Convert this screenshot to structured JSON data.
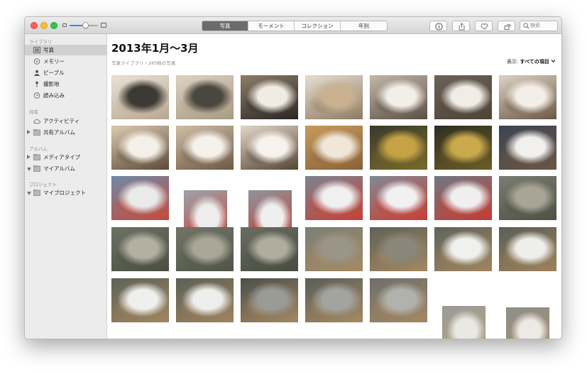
{
  "window": {
    "tabs": [
      {
        "label": "写真",
        "active": true
      },
      {
        "label": "モーメント",
        "active": false
      },
      {
        "label": "コレクション",
        "active": false
      },
      {
        "label": "年別",
        "active": false
      }
    ],
    "toolbar_icons": [
      "info-icon",
      "share-icon",
      "heart-icon",
      "rotate-icon"
    ],
    "search_placeholder": "検索",
    "zoom_slider_value": 0.55
  },
  "sidebar": {
    "library_header": "ライブラリ",
    "library_items": [
      {
        "label": "写真",
        "icon": "photos-icon",
        "selected": true
      },
      {
        "label": "メモリー",
        "icon": "memories-icon",
        "selected": false
      },
      {
        "label": "ピープル",
        "icon": "people-icon",
        "selected": false
      },
      {
        "label": "撮影地",
        "icon": "places-pin-icon",
        "selected": false
      },
      {
        "label": "読み込み",
        "icon": "imports-clock-icon",
        "selected": false
      }
    ],
    "shared_header": "共有",
    "shared_items": [
      {
        "label": "アクティビティ",
        "icon": "cloud-icon",
        "disclosure": "none"
      },
      {
        "label": "共有アルバム",
        "icon": "folder-icon",
        "disclosure": "collapsed"
      }
    ],
    "albums_header": "アルバム",
    "album_items": [
      {
        "label": "メディアタイプ",
        "icon": "folder-icon",
        "disclosure": "collapsed"
      },
      {
        "label": "マイアルバム",
        "icon": "folder-icon",
        "disclosure": "expanded"
      }
    ],
    "projects_header": "プロジェクト",
    "project_items": [
      {
        "label": "マイプロジェクト",
        "icon": "folder-icon",
        "disclosure": "expanded"
      }
    ]
  },
  "main": {
    "title": "2013年1月〜3月",
    "subtitle": "写真ライブラリ・265枚の写真",
    "display_label": "表示:",
    "display_value": "すべての項目",
    "photos": [
      {
        "subject": "cat-on-wooden-step",
        "colors": [
          "#e9e2d6",
          "#3b3a35",
          "#b8a891"
        ]
      },
      {
        "subject": "cat-on-wooden-step",
        "colors": [
          "#ddd3c2",
          "#4a4640",
          "#a89a82"
        ]
      },
      {
        "subject": "cat-closeup-sitting",
        "colors": [
          "#8d7e6a",
          "#f0ece4",
          "#2a2622"
        ]
      },
      {
        "subject": "blurry-cat-face",
        "colors": [
          "#e7ded1",
          "#c9b190",
          "#8f7b64"
        ]
      },
      {
        "subject": "cat-face-closeup",
        "colors": [
          "#c2b8a9",
          "#f2efe9",
          "#5c5046"
        ]
      },
      {
        "subject": "cat-face-closeup",
        "colors": [
          "#6b6358",
          "#f1ede6",
          "#4f4338"
        ]
      },
      {
        "subject": "cat-face-closeup",
        "colors": [
          "#dcd2c4",
          "#f3efe8",
          "#6b5945"
        ]
      },
      {
        "subject": "cat-looking-down",
        "colors": [
          "#dccbb2",
          "#f4f0e9",
          "#5d4a36"
        ]
      },
      {
        "subject": "cat-looking-down",
        "colors": [
          "#cfbea6",
          "#f5f2ec",
          "#6e5843"
        ]
      },
      {
        "subject": "cat-lying",
        "colors": [
          "#e1d8c9",
          "#f6f3ee",
          "#554434"
        ]
      },
      {
        "subject": "cat-fur-blur",
        "colors": [
          "#c79a5e",
          "#f0e7d8",
          "#8a6237"
        ]
      },
      {
        "subject": "striped-fur-closeup",
        "colors": [
          "#3a3a2c",
          "#c4a245",
          "#7a6b2b"
        ]
      },
      {
        "subject": "striped-fur-closeup",
        "colors": [
          "#2e2e22",
          "#caa84c",
          "#6c5d26"
        ]
      },
      {
        "subject": "cat-lying-wooden-floor",
        "colors": [
          "#3c4452",
          "#f2f0ec",
          "#6a5744"
        ]
      },
      {
        "subject": "cat-with-heart-toy",
        "colors": [
          "#6e8aa8",
          "#eaeaea",
          "#c64a3a"
        ]
      },
      {
        "subject": "cat-with-heart-toy-tilted",
        "colors": [
          "#9ba3aa",
          "#ededed",
          "#cc3c32"
        ]
      },
      {
        "subject": "cat-with-heart-toy-tilted",
        "colors": [
          "#8d959c",
          "#efefef",
          "#c43630"
        ]
      },
      {
        "subject": "cat-with-heart-toy",
        "colors": [
          "#7c8590",
          "#f0f0f0",
          "#c74035"
        ]
      },
      {
        "subject": "cat-with-heart-toy",
        "colors": [
          "#818a94",
          "#f1f1f1",
          "#c93e33"
        ]
      },
      {
        "subject": "cat-with-heart-toy",
        "colors": [
          "#6f7985",
          "#efefef",
          "#c53b31"
        ]
      },
      {
        "subject": "shrine-cat-stone-steps",
        "colors": [
          "#7a7d72",
          "#a8a596",
          "#4d5142"
        ]
      },
      {
        "subject": "shrine-cat-stone-steps",
        "colors": [
          "#6d7266",
          "#b3b0a2",
          "#4a4f40"
        ]
      },
      {
        "subject": "shrine-cat-stone-steps",
        "colors": [
          "#727669",
          "#a9a698",
          "#505547"
        ]
      },
      {
        "subject": "shrine-cat-stone-steps",
        "colors": [
          "#6a6e62",
          "#b0ad9f",
          "#484c3f"
        ]
      },
      {
        "subject": "tabby-cat-on-steps",
        "colors": [
          "#7b7f77",
          "#9a9587",
          "#a58a63"
        ]
      },
      {
        "subject": "tabby-cat-sitting",
        "colors": [
          "#5f6259",
          "#8a8679",
          "#a48862"
        ]
      },
      {
        "subject": "shrine-cats-paper-streamers",
        "colors": [
          "#60645a",
          "#f0f0ee",
          "#a0855f"
        ]
      },
      {
        "subject": "shrine-cats-paper-streamers",
        "colors": [
          "#5b5f55",
          "#eeeeec",
          "#9e835d"
        ]
      },
      {
        "subject": "shrine-cats-streamers",
        "colors": [
          "#5e6258",
          "#efefed",
          "#a1865f"
        ]
      },
      {
        "subject": "shrine-cats-streamers",
        "colors": [
          "#5c6056",
          "#eeeeec",
          "#9f845e"
        ]
      },
      {
        "subject": "tabby-cat-on-path",
        "colors": [
          "#4c4e49",
          "#9a9a96",
          "#a48863"
        ]
      },
      {
        "subject": "tabby-cat-on-path",
        "colors": [
          "#5b5d58",
          "#a3a39f",
          "#a68a64"
        ]
      },
      {
        "subject": "tabby-cat-walking",
        "colors": [
          "#6e6f6b",
          "#b1b1ad",
          "#a48864"
        ]
      },
      {
        "subject": "white-cat-on-blanket",
        "colors": [
          "#9a9c98",
          "#e9e8e4",
          "#b9a27e"
        ]
      },
      {
        "subject": "cat-in-bedding",
        "colors": [
          "#8e8f8a",
          "#eceae6",
          "#a88e6a"
        ]
      }
    ]
  }
}
